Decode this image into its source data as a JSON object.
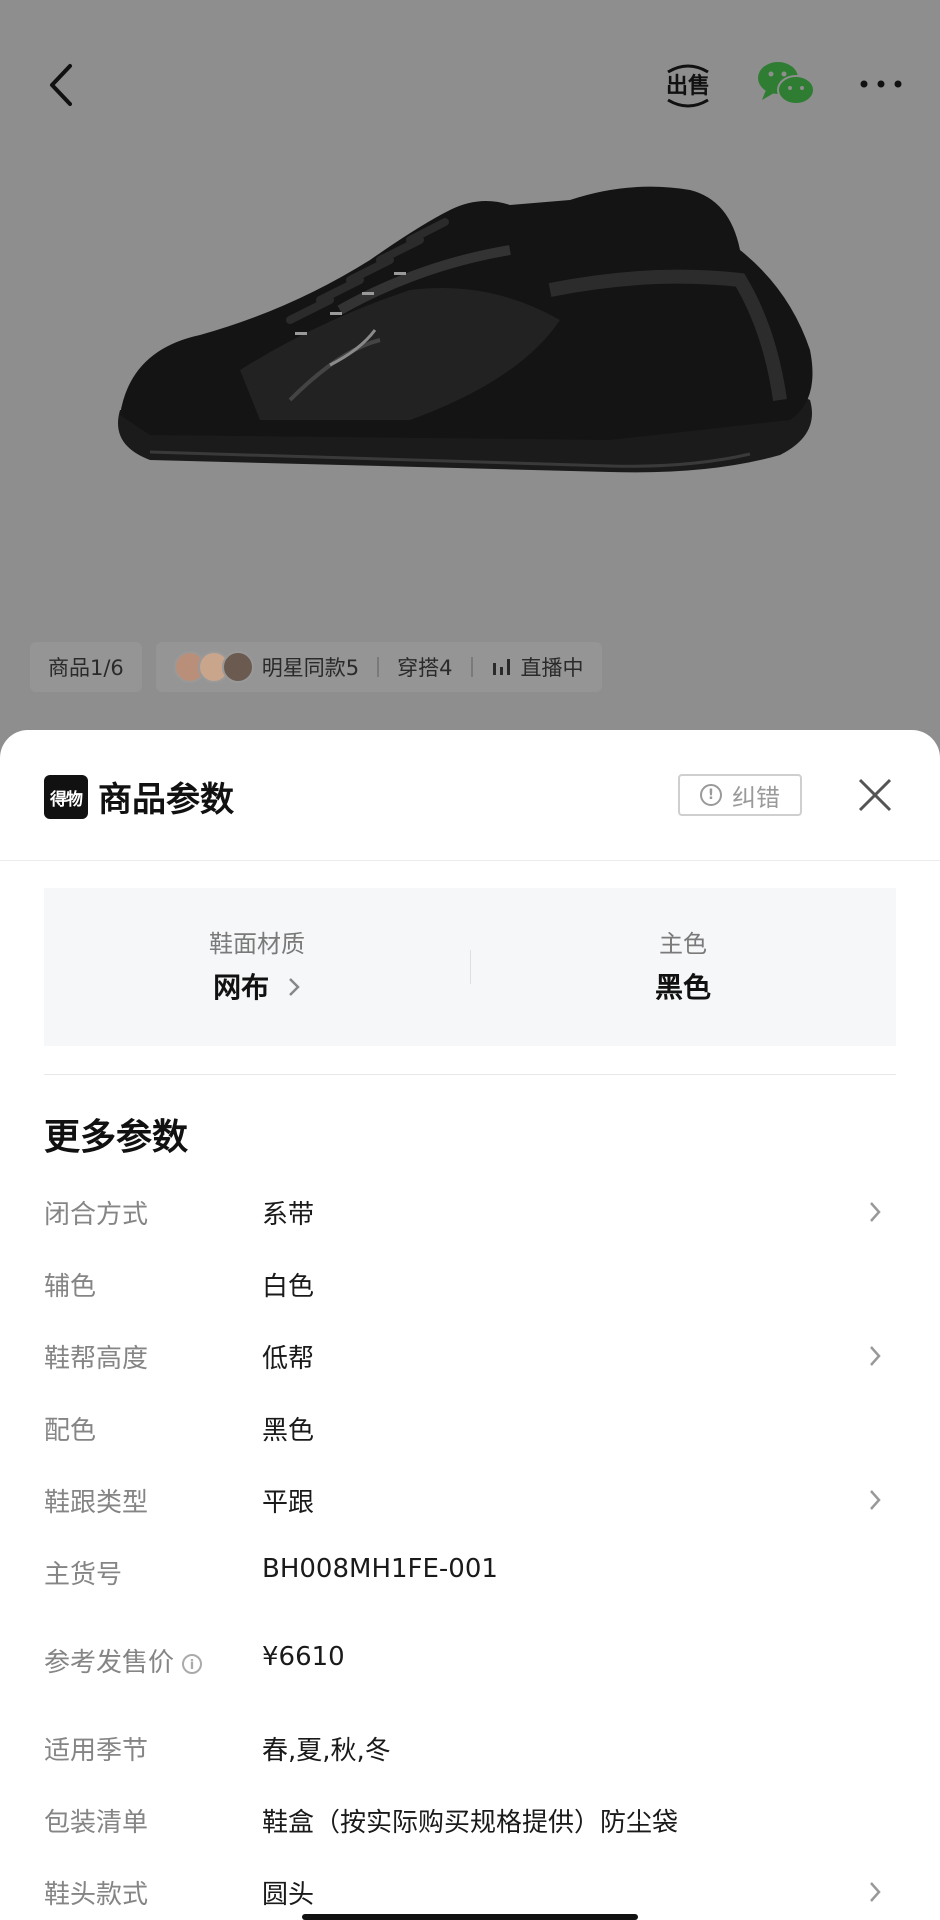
{
  "header": {
    "back_icon": "chevron-left-icon",
    "sell_label": "出售",
    "wechat_icon": "wechat-icon",
    "more_icon": "more-dots-icon"
  },
  "chips": {
    "product_index": "商品1/6",
    "celebrity": "明星同款5",
    "outfits": "穿搭4",
    "live": "直播中"
  },
  "sheet": {
    "logo": "得物",
    "title": "商品参数",
    "report_label": "纠错",
    "close_icon": "close-icon"
  },
  "main_params": [
    {
      "label": "鞋面材质",
      "value": "网布",
      "has_arrow": true
    },
    {
      "label": "主色",
      "value": "黑色",
      "has_arrow": false
    }
  ],
  "more_params_title": "更多参数",
  "params": [
    {
      "label": "闭合方式",
      "value": "系带",
      "has_arrow": true
    },
    {
      "label": "辅色",
      "value": "白色",
      "has_arrow": false
    },
    {
      "label": "鞋帮高度",
      "value": "低帮",
      "has_arrow": true
    },
    {
      "label": "配色",
      "value": "黑色",
      "has_arrow": false
    },
    {
      "label": "鞋跟类型",
      "value": "平跟",
      "has_arrow": true
    },
    {
      "label": "主货号",
      "value": "BH008MH1FE-001",
      "has_arrow": false
    },
    {
      "label": "参考发售价",
      "value": "¥6610",
      "has_arrow": false,
      "has_info": true
    },
    {
      "label": "适用季节",
      "value": "春,夏,秋,冬",
      "has_arrow": false
    },
    {
      "label": "包装清单",
      "value": "鞋盒（按实际购买规格提供）防尘袋",
      "has_arrow": false
    },
    {
      "label": "鞋头款式",
      "value": "圆头",
      "has_arrow": true
    }
  ],
  "colors": {
    "overlay": "#8e8e8e",
    "sheet_bg": "#ffffff",
    "label_gray": "#858585",
    "text_dark": "#1a1a1a",
    "wechat_green": "#2e7d32"
  }
}
